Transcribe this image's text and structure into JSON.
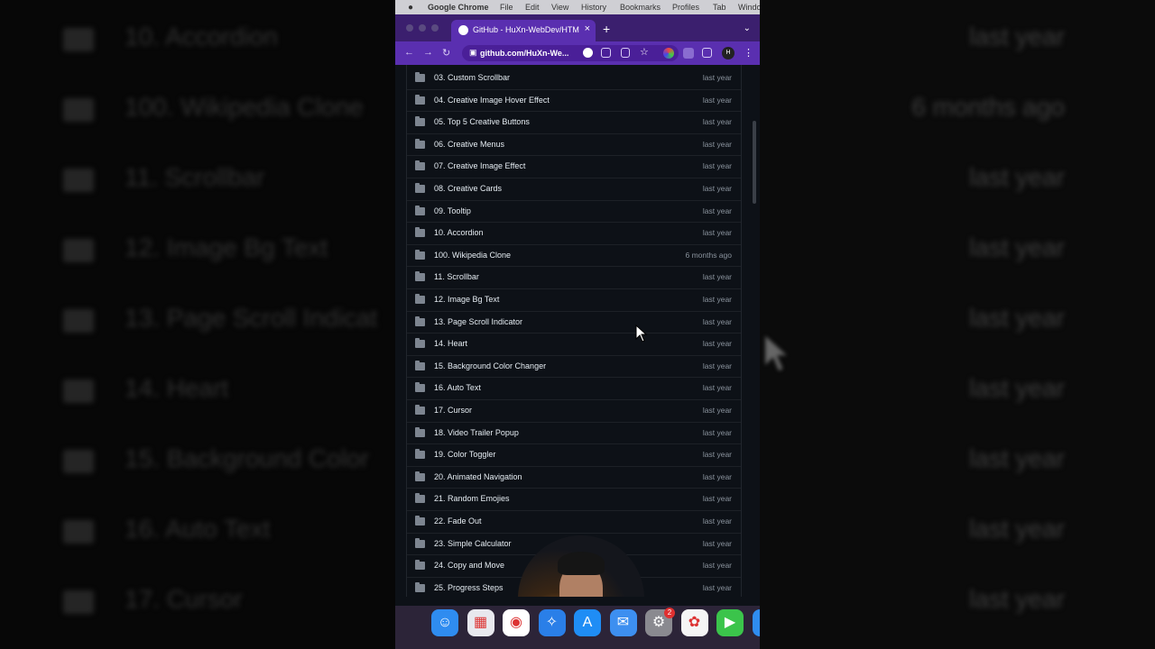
{
  "menubar": {
    "apple": "",
    "app_name": "Google Chrome",
    "items": [
      "File",
      "Edit",
      "View",
      "History",
      "Bookmarks",
      "Profiles",
      "Tab",
      "Windo"
    ]
  },
  "browser": {
    "tab_title": "GitHub - HuXn-WebDev/HTML",
    "new_tab": "+",
    "tab_close": "×",
    "tab_dropdown": "⌄",
    "url": "github.com/HuXn-We...",
    "avatar": "H",
    "menu": "⋮",
    "back": "←",
    "forward": "→",
    "reload": "↻",
    "lock": "🔒"
  },
  "files": [
    {
      "name": "03. Custom Scrollbar",
      "date": "last year"
    },
    {
      "name": "04. Creative Image Hover Effect",
      "date": "last year"
    },
    {
      "name": "05. Top 5 Creative Buttons",
      "date": "last year"
    },
    {
      "name": "06. Creative Menus",
      "date": "last year"
    },
    {
      "name": "07. Creative Image Effect",
      "date": "last year"
    },
    {
      "name": "08. Creative Cards",
      "date": "last year"
    },
    {
      "name": "09. Tooltip",
      "date": "last year"
    },
    {
      "name": "10. Accordion",
      "date": "last year"
    },
    {
      "name": "100. Wikipedia Clone",
      "date": "6 months ago"
    },
    {
      "name": "11. Scrollbar",
      "date": "last year"
    },
    {
      "name": "12. Image Bg Text",
      "date": "last year"
    },
    {
      "name": "13. Page Scroll Indicator",
      "date": "last year"
    },
    {
      "name": "14. Heart",
      "date": "last year"
    },
    {
      "name": "15. Background Color Changer",
      "date": "last year"
    },
    {
      "name": "16. Auto Text",
      "date": "last year"
    },
    {
      "name": "17. Cursor",
      "date": "last year"
    },
    {
      "name": "18. Video Trailer Popup",
      "date": "last year"
    },
    {
      "name": "19. Color Toggler",
      "date": "last year"
    },
    {
      "name": "20. Animated Navigation",
      "date": "last year"
    },
    {
      "name": "21. Random Emojies",
      "date": "last year"
    },
    {
      "name": "22. Fade Out",
      "date": "last year"
    },
    {
      "name": "23. Simple Calculator",
      "date": "last year"
    },
    {
      "name": "24. Copy and Move",
      "date": "last year"
    },
    {
      "name": "25. Progress Steps",
      "date": "last year"
    }
  ],
  "background_rows": [
    {
      "name": "10. Accordion",
      "date": "last year"
    },
    {
      "name": "100. Wikipedia Clone",
      "date": "6 months ago"
    },
    {
      "name": "11. Scrollbar",
      "date": "last year"
    },
    {
      "name": "12. Image Bg Text",
      "date": "last year"
    },
    {
      "name": "13. Page Scroll Indicat",
      "date": "last year"
    },
    {
      "name": "14. Heart",
      "date": "last year"
    },
    {
      "name": "15. Background Color",
      "date": "last year"
    },
    {
      "name": "16. Auto Text",
      "date": "last year"
    },
    {
      "name": "17. Cursor",
      "date": "last year"
    }
  ],
  "dock": {
    "apps": [
      {
        "name": "finder",
        "color": "#2f8cf0",
        "glyph": "☺"
      },
      {
        "name": "launchpad",
        "color": "#e8e8ee",
        "glyph": "▦"
      },
      {
        "name": "chrome",
        "color": "#ffffff",
        "glyph": "◉"
      },
      {
        "name": "safari",
        "color": "#2a7fe8",
        "glyph": "✧"
      },
      {
        "name": "app-store",
        "color": "#1f8df5",
        "glyph": "A"
      },
      {
        "name": "mail",
        "color": "#3d8ff0",
        "glyph": "✉"
      },
      {
        "name": "system-settings",
        "color": "#8a8a90",
        "glyph": "⚙"
      },
      {
        "name": "photos",
        "color": "#f5f5f5",
        "glyph": "✿"
      },
      {
        "name": "facetime",
        "color": "#3bc44b",
        "glyph": "▶"
      },
      {
        "name": "more",
        "color": "#2f8cf0",
        "glyph": "☺"
      }
    ],
    "settings_badge": "2"
  }
}
